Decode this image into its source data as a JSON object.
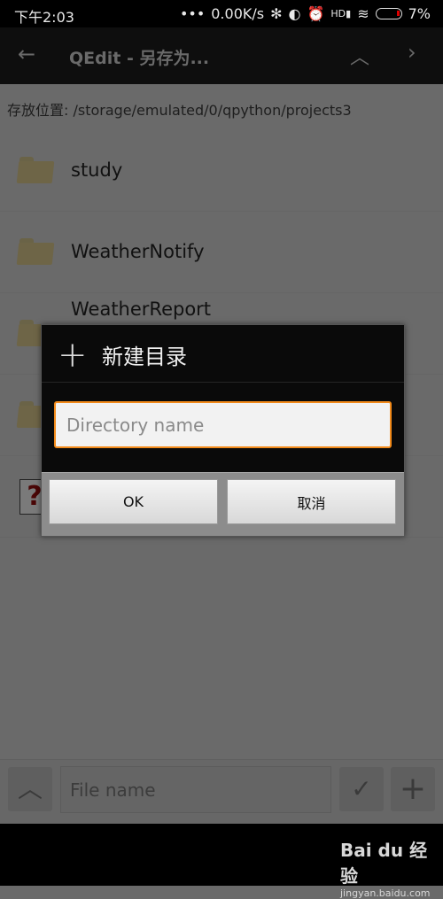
{
  "status_bar": {
    "time": "下午2:03",
    "network_speed": "0.00K/s",
    "network_type": "HD",
    "battery": "7%",
    "icons": [
      "dots-icon",
      "bluetooth-icon",
      "toggle-icon",
      "alarm-icon",
      "signal-icon",
      "wifi-icon",
      "battery-icon"
    ]
  },
  "toolbar": {
    "title": "QEdit - 另存为...",
    "back_icon": "arrow-left-icon",
    "up_icon": "chevron-up-icon",
    "next_icon": "chevron-right-icon"
  },
  "location": "存放位置: /storage/emulated/0/qpython/projects3",
  "files": [
    {
      "name": "study",
      "icon": "folder-icon"
    },
    {
      "name": "WeatherNotify",
      "icon": "folder-icon"
    },
    {
      "name": "WeatherReport",
      "icon": "folder-icon"
    },
    {
      "name": "",
      "icon": "folder-icon"
    },
    {
      "name": "",
      "icon": "unknown-file-icon"
    }
  ],
  "dialog": {
    "title": "新建目录",
    "input_placeholder": "Directory name",
    "input_value": "",
    "ok": "OK",
    "cancel": "取消",
    "accent": "#f28a1a"
  },
  "bottom_bar": {
    "file_name_placeholder": "File name",
    "file_name_value": ""
  },
  "watermark": {
    "logo": "Bai du 经验",
    "url": "jingyan.baidu.com"
  }
}
